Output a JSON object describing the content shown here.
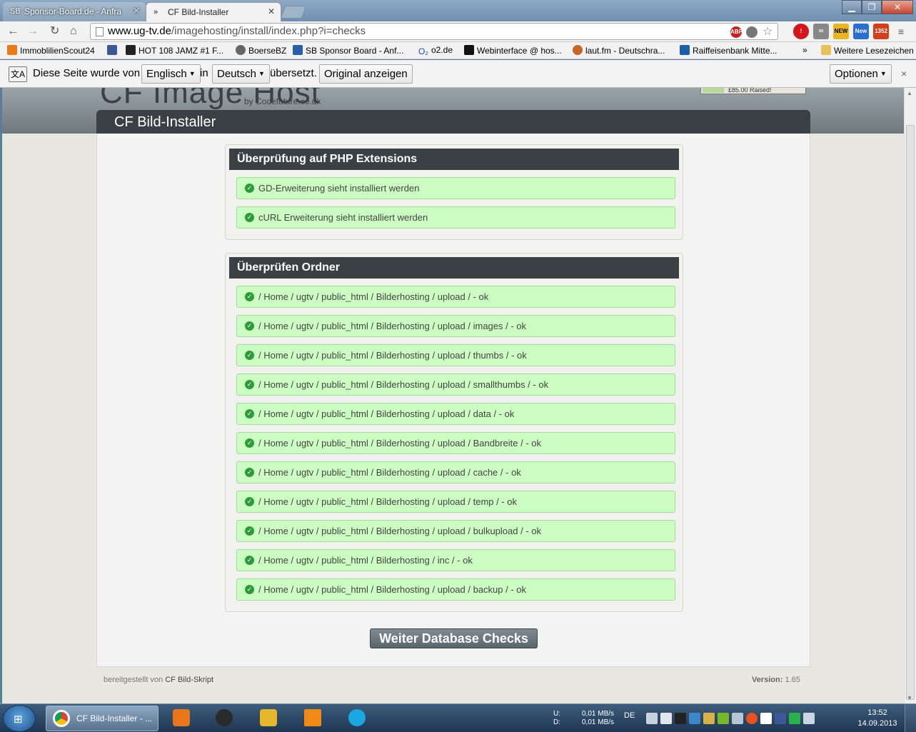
{
  "tabs": [
    {
      "title": "Sponsor-Board.de - Anfra",
      "active": false
    },
    {
      "title": "CF Bild-Installer",
      "active": true
    }
  ],
  "address": {
    "host": "www.ug-tv.de",
    "path": "/imagehosting/install/index.php?i=checks"
  },
  "extensions": [
    {
      "name": "abp-icon",
      "label": "ABP"
    },
    {
      "name": "new-badge-icon",
      "label": "NEW"
    },
    {
      "name": "new-badge-icon-2",
      "label": "New"
    },
    {
      "name": "count-badge-icon",
      "label": "1352"
    }
  ],
  "bookmarks": [
    {
      "label": "ImmoblilienScout24",
      "color": "#e87a1b"
    },
    {
      "label": "",
      "color": "#3b5998"
    },
    {
      "label": "HOT 108 JAMZ #1 F...",
      "color": "#222222"
    },
    {
      "label": "BoerseBZ",
      "color": "#666666"
    },
    {
      "label": "SB  Sponsor Board - Anf...",
      "color": "#2a5ea8"
    },
    {
      "label": "o2.de",
      "color": "#1b4fa0"
    },
    {
      "label": "Webinterface @ hos...",
      "color": "#111111"
    },
    {
      "label": "laut.fm - Deutschra...",
      "color": "#c86428"
    },
    {
      "label": "Raiffeisenbank Mitte...",
      "color": "#1c5fa8"
    },
    {
      "label": "»",
      "color": ""
    },
    {
      "label": "Weitere Lesezeichen",
      "color": "#e8c15b"
    }
  ],
  "translate": {
    "prefix": "Diese Seite wurde von",
    "from": "Englisch",
    "in": "in",
    "to": "Deutsch",
    "suffix": "übersetzt.",
    "show_original": "Original anzeigen",
    "options": "Optionen",
    "close": "×"
  },
  "page": {
    "logo": "CF Image Host",
    "logo_sub": "by Codefuture.co.uk",
    "donate": "£85.00 Raised!",
    "title": "CF Bild-Installer",
    "php_panel": {
      "heading": "Überprüfung auf PHP Extensions",
      "items": [
        "GD-Erweiterung sieht installiert werden",
        "cURL Erweiterung sieht installiert werden"
      ]
    },
    "folder_panel": {
      "heading": "Überprüfen Ordner",
      "items": [
        "/ Home / ugtv / public_html / Bilderhosting / upload / - ok",
        "/ Home / ugtv / public_html / Bilderhosting / upload / images / - ok",
        "/ Home / ugtv / public_html / Bilderhosting / upload / thumbs / - ok",
        "/ Home / ugtv / public_html / Bilderhosting / upload / smallthumbs / - ok",
        "/ Home / ugtv / public_html / Bilderhosting / upload / data / - ok",
        "/ Home / ugtv / public_html / Bilderhosting / upload / Bandbreite / - ok",
        "/ Home / ugtv / public_html / Bilderhosting / upload / cache / - ok",
        "/ Home / ugtv / public_html / Bilderhosting / upload / temp / - ok",
        "/ Home / ugtv / public_html / Bilderhosting / upload / bulkupload / - ok",
        "/ Home / ugtv / public_html / Bilderhosting / inc / - ok",
        "/ Home / ugtv / public_html / Bilderhosting / upload / backup / - ok"
      ]
    },
    "continue_button": "Weiter Database Checks",
    "footer_prefix": "bereitgestellt von",
    "footer_link": "CF Bild-Skript",
    "version_label": "Version:",
    "version": "1.65"
  },
  "taskbar": {
    "active_app": "CF Bild-Installer - ...",
    "net_up_label": "U:",
    "net_down_label": "D:",
    "net_up": "0,01 MB/s",
    "net_down": "0,01 MB/s",
    "lang": "DE",
    "time": "13:52",
    "date": "14.09.2013"
  }
}
